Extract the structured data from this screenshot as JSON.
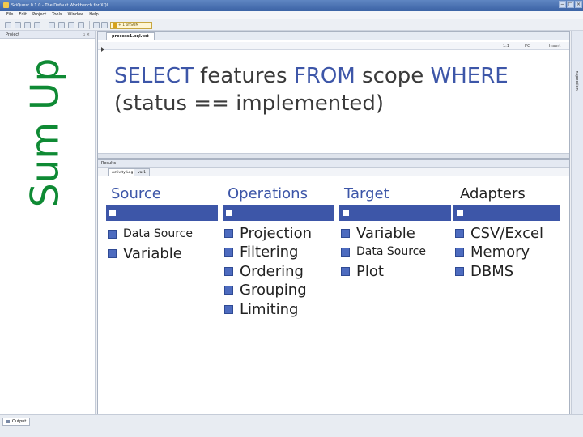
{
  "window": {
    "title": "SciQuest 0.1.0 - The Default Workbench for XQL",
    "controls": [
      "−",
      "□",
      "×"
    ]
  },
  "menu": [
    "File",
    "Edit",
    "Project",
    "Tools",
    "Window",
    "Help"
  ],
  "toolbar": {
    "widget_label": "+ 1 of SUM"
  },
  "project_panel": {
    "title": "Project"
  },
  "slide_title": "Sum Up",
  "editor": {
    "tab": "process1.xql.txt",
    "status": [
      "1:1",
      "PC",
      "Insert"
    ],
    "query": {
      "k1": "SELECT",
      "t1": " features ",
      "k2": "FROM",
      "t2": " scope ",
      "k3": "WHERE",
      "line2": "(status == implemented)"
    }
  },
  "results": {
    "title": "Results",
    "tabs": [
      "Activity Log",
      "var1"
    ]
  },
  "columns": [
    {
      "heading": "Source",
      "items": [
        "Data Source",
        "Variable"
      ]
    },
    {
      "heading": "Operations",
      "items": [
        "Projection",
        "Filtering",
        "Ordering",
        "Grouping",
        "Limiting"
      ]
    },
    {
      "heading": "Target",
      "items": [
        "Variable",
        "Data Source",
        "Plot"
      ]
    },
    {
      "heading": "Adapters",
      "items": [
        "CSV/Excel",
        "Memory",
        "DBMS"
      ]
    }
  ],
  "inspector": {
    "label": "Inspection"
  },
  "output": {
    "tab": "Output"
  },
  "colors": {
    "accent": "#3d56a8",
    "title_green": "#0f8a34"
  }
}
